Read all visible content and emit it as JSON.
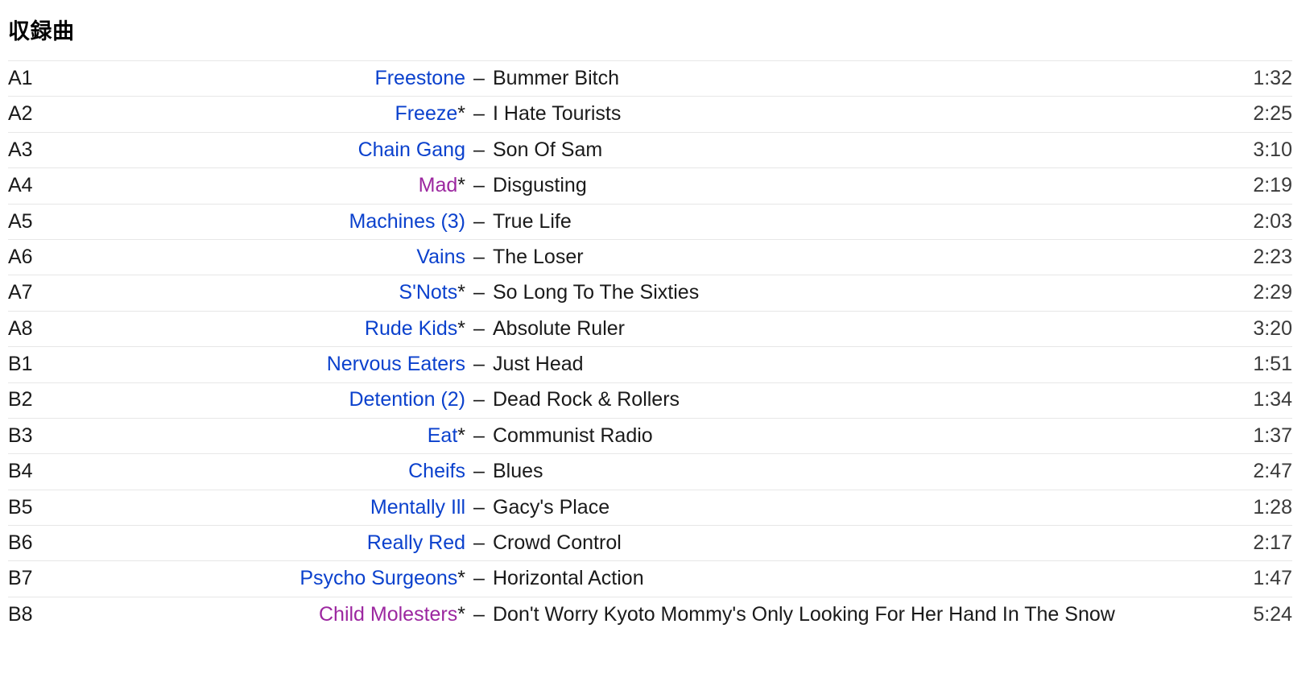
{
  "section": {
    "heading": "収録曲",
    "dash": "–",
    "asterisk": "*"
  },
  "colors": {
    "link_unvisited": "#0b41cd",
    "link_visited": "#9c27a0",
    "text": "#1a1a1a",
    "duration": "#3a3a3a",
    "row_separator": "#e7e7e7",
    "background": "#ffffff"
  },
  "tracks": [
    {
      "position": "A1",
      "artist": "Freestone",
      "artist_state": "unvisited",
      "starred": false,
      "title": "Bummer Bitch",
      "duration": "1:32"
    },
    {
      "position": "A2",
      "artist": "Freeze",
      "artist_state": "unvisited",
      "starred": true,
      "title": "I Hate Tourists",
      "duration": "2:25"
    },
    {
      "position": "A3",
      "artist": "Chain Gang",
      "artist_state": "unvisited",
      "starred": false,
      "title": "Son Of Sam",
      "duration": "3:10"
    },
    {
      "position": "A4",
      "artist": "Mad",
      "artist_state": "visited",
      "starred": true,
      "title": "Disgusting",
      "duration": "2:19"
    },
    {
      "position": "A5",
      "artist": "Machines (3)",
      "artist_state": "unvisited",
      "starred": false,
      "title": "True Life",
      "duration": "2:03"
    },
    {
      "position": "A6",
      "artist": "Vains",
      "artist_state": "unvisited",
      "starred": false,
      "title": "The Loser",
      "duration": "2:23"
    },
    {
      "position": "A7",
      "artist": "S'Nots",
      "artist_state": "unvisited",
      "starred": true,
      "title": "So Long To The Sixties",
      "duration": "2:29"
    },
    {
      "position": "A8",
      "artist": "Rude Kids",
      "artist_state": "unvisited",
      "starred": true,
      "title": "Absolute Ruler",
      "duration": "3:20"
    },
    {
      "position": "B1",
      "artist": "Nervous Eaters",
      "artist_state": "unvisited",
      "starred": false,
      "title": "Just Head",
      "duration": "1:51"
    },
    {
      "position": "B2",
      "artist": "Detention (2)",
      "artist_state": "unvisited",
      "starred": false,
      "title": "Dead Rock & Rollers",
      "duration": "1:34"
    },
    {
      "position": "B3",
      "artist": "Eat",
      "artist_state": "unvisited",
      "starred": true,
      "title": "Communist Radio",
      "duration": "1:37"
    },
    {
      "position": "B4",
      "artist": "Cheifs",
      "artist_state": "unvisited",
      "starred": false,
      "title": "Blues",
      "duration": "2:47"
    },
    {
      "position": "B5",
      "artist": "Mentally Ill",
      "artist_state": "unvisited",
      "starred": false,
      "title": "Gacy's Place",
      "duration": "1:28"
    },
    {
      "position": "B6",
      "artist": "Really Red",
      "artist_state": "unvisited",
      "starred": false,
      "title": "Crowd Control",
      "duration": "2:17"
    },
    {
      "position": "B7",
      "artist": "Psycho Surgeons",
      "artist_state": "unvisited",
      "starred": true,
      "title": "Horizontal Action",
      "duration": "1:47"
    },
    {
      "position": "B8",
      "artist": "Child Molesters",
      "artist_state": "visited",
      "starred": true,
      "title": "Don't Worry Kyoto Mommy's Only Looking For Her Hand In The Snow",
      "duration": "5:24"
    }
  ]
}
